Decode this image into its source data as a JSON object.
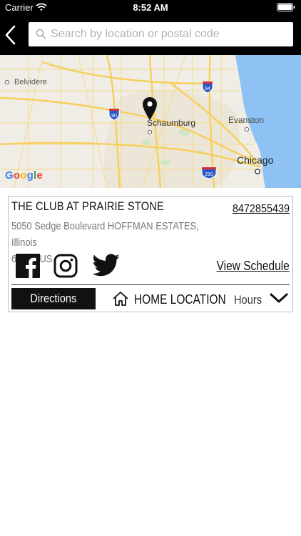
{
  "status_bar": {
    "carrier": "Carrier",
    "time": "8:52 AM"
  },
  "header": {
    "back_icon": "chevron-left-icon",
    "search_placeholder": "Search by location or postal code",
    "search_value": ""
  },
  "map": {
    "labels": {
      "belvidere": "Belvidere",
      "schaumburg": "Schaumburg",
      "evanston": "Evanston",
      "chicago": "Chicago"
    },
    "highway_shields": {
      "i90": "90",
      "i94": "94",
      "i290": "290"
    },
    "provider": [
      "G",
      "o",
      "o",
      "g",
      "l",
      "e"
    ],
    "colors": {
      "water": "#8ec2f4",
      "land": "#f0ede6",
      "roads": "#f6cf5b",
      "interstate": "#2a56c6"
    }
  },
  "club": {
    "name": "THE CLUB AT PRAIRIE STONE",
    "phone": "8472855439",
    "address_line1": "5050 Sedge Boulevard  HOFFMAN ESTATES, Illinois",
    "address_line2": "60192 US",
    "social_icons": [
      "facebook-icon",
      "instagram-icon",
      "twitter-icon"
    ],
    "view_schedule_label": "View Schedule",
    "directions_label": "Directions",
    "home_location_label": "HOME LOCATION",
    "hours_label": "Hours"
  }
}
